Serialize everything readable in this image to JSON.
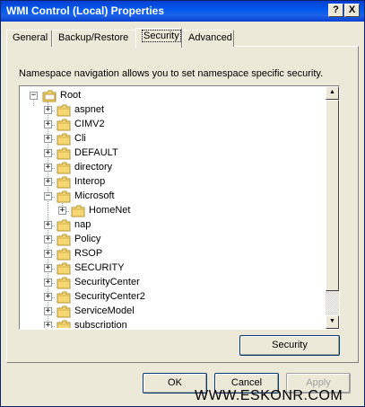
{
  "window": {
    "title": "WMI Control (Local) Properties",
    "help_label": "?",
    "close_label": "X"
  },
  "tabs": [
    {
      "label": "General",
      "active": false
    },
    {
      "label": "Backup/Restore",
      "active": false
    },
    {
      "label": "Security",
      "active": true
    },
    {
      "label": "Advanced",
      "active": false
    }
  ],
  "security_tab": {
    "description": "Namespace navigation allows you to set namespace specific security.",
    "security_button": "Security"
  },
  "tree": {
    "root": {
      "label": "Root",
      "expander": "−"
    },
    "children": [
      {
        "label": "aspnet",
        "expander": "+"
      },
      {
        "label": "CIMV2",
        "expander": "+"
      },
      {
        "label": "Cli",
        "expander": "+"
      },
      {
        "label": "DEFAULT",
        "expander": "+"
      },
      {
        "label": "directory",
        "expander": "+"
      },
      {
        "label": "Interop",
        "expander": "+"
      },
      {
        "label": "Microsoft",
        "expander": "−"
      },
      {
        "label": "HomeNet",
        "expander": "+",
        "level": 2
      },
      {
        "label": "nap",
        "expander": "+"
      },
      {
        "label": "Policy",
        "expander": "+"
      },
      {
        "label": "RSOP",
        "expander": "+"
      },
      {
        "label": "SECURITY",
        "expander": "+"
      },
      {
        "label": "SecurityCenter",
        "expander": "+"
      },
      {
        "label": "SecurityCenter2",
        "expander": "+"
      },
      {
        "label": "ServiceModel",
        "expander": "+"
      },
      {
        "label": "subscription",
        "expander": "+"
      }
    ]
  },
  "footer": {
    "ok": "OK",
    "cancel": "Cancel",
    "apply": "Apply"
  },
  "watermark": "WWW.ESKONR.COM",
  "colors": {
    "titlebar": "#0058ee",
    "window_bg": "#ece9d8",
    "folder": "#f5d774"
  }
}
